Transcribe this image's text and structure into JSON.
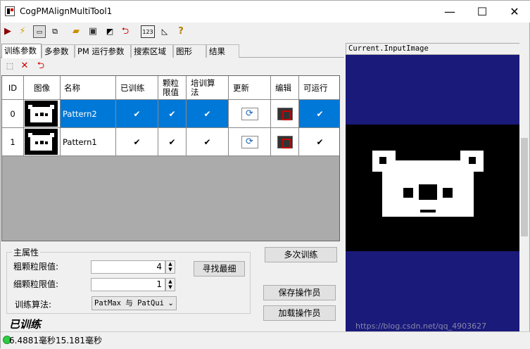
{
  "window": {
    "title": "CogPMAlignMultiTool1",
    "minimize": "—",
    "maximize": "☐",
    "close": "✕"
  },
  "toolbar": {
    "icons": [
      "run-icon",
      "electric-icon",
      "live-image-icon",
      "image-source-icon",
      "open-folder-icon",
      "save-icon",
      "save-edit-icon",
      "reset-icon",
      "numeric-icon",
      "ruler-icon",
      "help-icon"
    ]
  },
  "tabs": [
    "训练参数",
    "多参数",
    "PM 运行参数",
    "搜索区域",
    "图形",
    "结果"
  ],
  "grid": {
    "headers": [
      "ID",
      "图像",
      "名称",
      "已训练",
      "颗粒限值",
      "培训算法",
      "更新",
      "编辑",
      "可运行"
    ],
    "rows": [
      {
        "id": "0",
        "name": "Pattern2",
        "trained": "✔",
        "granularity": "✔",
        "algorithm": "✔",
        "runnable": "✔",
        "selected": true
      },
      {
        "id": "1",
        "name": "Pattern1",
        "trained": "✔",
        "granularity": "✔",
        "algorithm": "✔",
        "runnable": "✔",
        "selected": false
      }
    ]
  },
  "properties": {
    "group_title": "主属性",
    "coarse_label": "粗颗粒限值:",
    "coarse_value": "4",
    "fine_label": "细颗粒限值:",
    "fine_value": "1",
    "algorithm_label": "训练算法:",
    "algorithm_value": "PatMax 与 PatQui"
  },
  "buttons": {
    "find_optimal": "寻找最细",
    "multi_train": "多次训练",
    "save_operator": "保存操作员",
    "load_operator": "加载操作员"
  },
  "trained_status": "已训练",
  "image_panel": {
    "title": "Current.InputImage",
    "watermark": "https://blog.csdn.net/qq_4903627"
  },
  "statusbar": {
    "times": "6.4881毫秒15.181毫秒",
    "status_color": "#2ecc40"
  }
}
